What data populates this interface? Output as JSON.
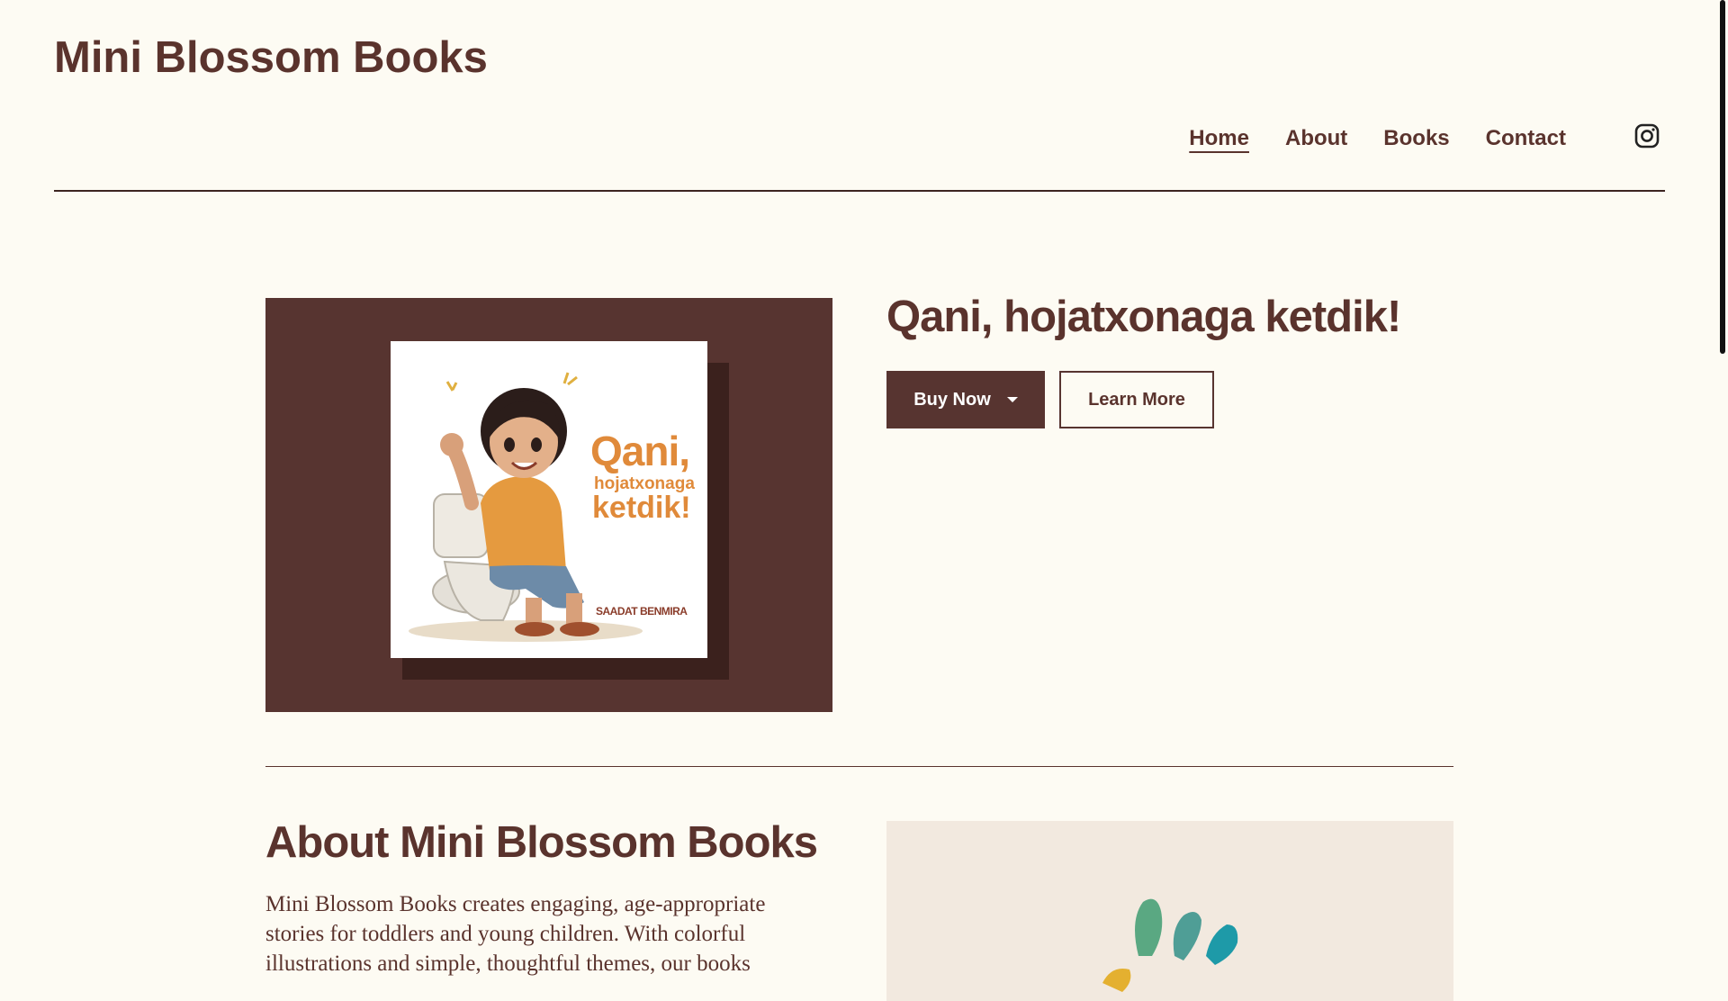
{
  "site": {
    "title": "Mini Blossom Books"
  },
  "nav": {
    "items": [
      {
        "label": "Home",
        "active": true
      },
      {
        "label": "About",
        "active": false
      },
      {
        "label": "Books",
        "active": false
      },
      {
        "label": "Contact",
        "active": false
      }
    ],
    "social_icon": "instagram-icon"
  },
  "hero": {
    "book_title": "Qani, hojatxonaga ketdik!",
    "buy_label": "Buy Now",
    "learn_label": "Learn More",
    "cover": {
      "title_line1": "Qani,",
      "title_line2": "hojatxonaga",
      "title_line3": "ketdik!",
      "author": "SAADAT BENMIRA"
    }
  },
  "about": {
    "title": "About Mini Blossom Books",
    "text": "Mini Blossom Books creates engaging, age-appropriate stories for toddlers and young children. With colorful illustrations and simple, thoughtful themes, our books"
  },
  "colors": {
    "background": "#fdfbf3",
    "brand_brown": "#573430",
    "text_brown": "#5a332d",
    "cover_orange": "#e08a3a"
  }
}
